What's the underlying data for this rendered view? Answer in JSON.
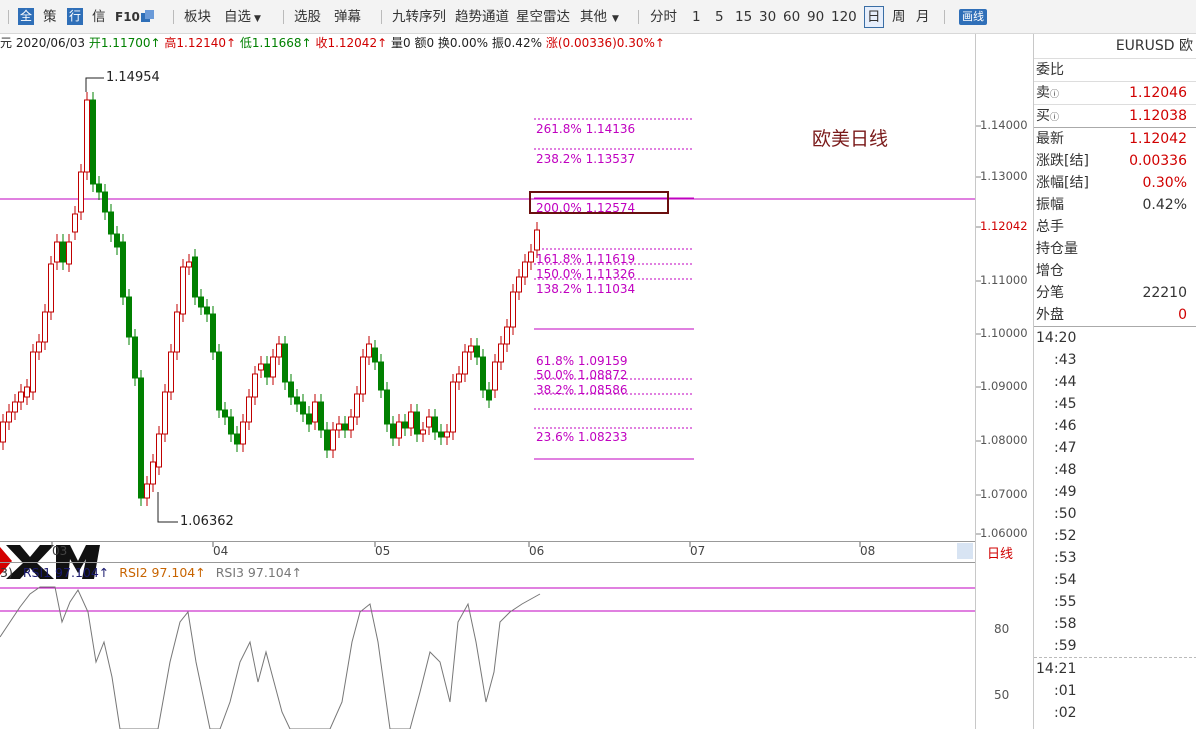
{
  "toolbar": {
    "items": [
      {
        "label": "全",
        "style": "box-blue"
      },
      {
        "label": "策",
        "style": "text"
      },
      {
        "label": "行",
        "style": "box-blue"
      },
      {
        "label": "信",
        "style": "text"
      },
      {
        "label": "F10",
        "style": "text"
      },
      {
        "label": "板块",
        "style": "text"
      },
      {
        "label": "自选",
        "style": "dropdown"
      },
      {
        "label": "选股",
        "style": "text"
      },
      {
        "label": "弹幕",
        "style": "text"
      },
      {
        "label": "九转序列",
        "style": "text"
      },
      {
        "label": "趋势通道",
        "style": "text"
      },
      {
        "label": "星空雷达",
        "style": "text"
      },
      {
        "label": "其他",
        "style": "dropdown"
      },
      {
        "label": "分时",
        "style": "text"
      },
      {
        "label": "1",
        "style": "text"
      },
      {
        "label": "5",
        "style": "text"
      },
      {
        "label": "15",
        "style": "text"
      },
      {
        "label": "30",
        "style": "text"
      },
      {
        "label": "60",
        "style": "text"
      },
      {
        "label": "90",
        "style": "text"
      },
      {
        "label": "120",
        "style": "text"
      },
      {
        "label": "日",
        "style": "active"
      },
      {
        "label": "周",
        "style": "text"
      },
      {
        "label": "月",
        "style": "text"
      },
      {
        "label": "画线",
        "style": "btn-blue"
      }
    ]
  },
  "info": {
    "prefix": "元",
    "date": "2020/06/03",
    "open_label": "开",
    "open": "1.11700↑",
    "high_label": "高",
    "high": "1.12140↑",
    "low_label": "低",
    "low": "1.11668↑",
    "close_label": "收",
    "close": "1.12042↑",
    "vol": "量0",
    "amt": "额0",
    "turnover": "换0.00%",
    "amplitude": "振0.42%",
    "change": "涨(0.00336)0.30%↑"
  },
  "chart": {
    "title": "欧美日线",
    "high_label": "1.14954",
    "low_label": "1.06362",
    "current_price_label": "1.12042",
    "yaxis_labels": [
      "1.14000",
      "1.13000",
      "1.12042",
      "1.11000",
      "1.10000",
      "1.09000",
      "1.08000",
      "1.07000",
      "1.06000"
    ],
    "date_labels": [
      "03",
      "04",
      "05",
      "06",
      "07",
      "08"
    ],
    "right_tag": "日线"
  },
  "fib": [
    {
      "label": "261.8% 1.14136"
    },
    {
      "label": "238.2% 1.13537"
    },
    {
      "label": "200.0% 1.12574"
    },
    {
      "label": "161.8% 1.11619"
    },
    {
      "label": "150.0% 1.11326"
    },
    {
      "label": "138.2% 1.11034"
    },
    {
      "label": "61.8% 1.09159"
    },
    {
      "label": "50.0% 1.08872"
    },
    {
      "label": "38.2% 1.08586"
    },
    {
      "label": "23.6% 1.08233"
    }
  ],
  "rsi": {
    "prefix": "3)",
    "rsi1": "RSI1 97.104↑",
    "rsi2": "RSI2 97.104↑",
    "rsi3": "RSI3 97.104↑",
    "axis": [
      "80",
      "50"
    ]
  },
  "panel": {
    "symbol": "EURUSD 欧",
    "weibi": "委比",
    "sell_label": "卖",
    "sell": "1.12046",
    "buy_label": "买",
    "buy": "1.12038",
    "rows": [
      {
        "label": "最新",
        "value": "1.12042"
      },
      {
        "label": "涨跌[结]",
        "value": "0.00336"
      },
      {
        "label": "涨幅[结]",
        "value": "0.30%"
      },
      {
        "label": "振幅",
        "value": "0.42%"
      },
      {
        "label": "总手",
        "value": ""
      },
      {
        "label": "持仓量",
        "value": ""
      },
      {
        "label": "增仓",
        "value": ""
      },
      {
        "label": "分笔",
        "value": "22210"
      },
      {
        "label": "外盘",
        "value": "0"
      }
    ],
    "ticks": [
      "14:20",
      ":43",
      ":44",
      ":45",
      ":46",
      ":47",
      ":48",
      ":49",
      ":50",
      ":52",
      ":53",
      ":54",
      ":55",
      ":58",
      ":59",
      "14:21",
      ":01",
      ":02"
    ]
  },
  "colors": {
    "up": "#c00000",
    "down": "#008000",
    "fib": "#c000c0",
    "accent": "#2f6fb8"
  }
}
